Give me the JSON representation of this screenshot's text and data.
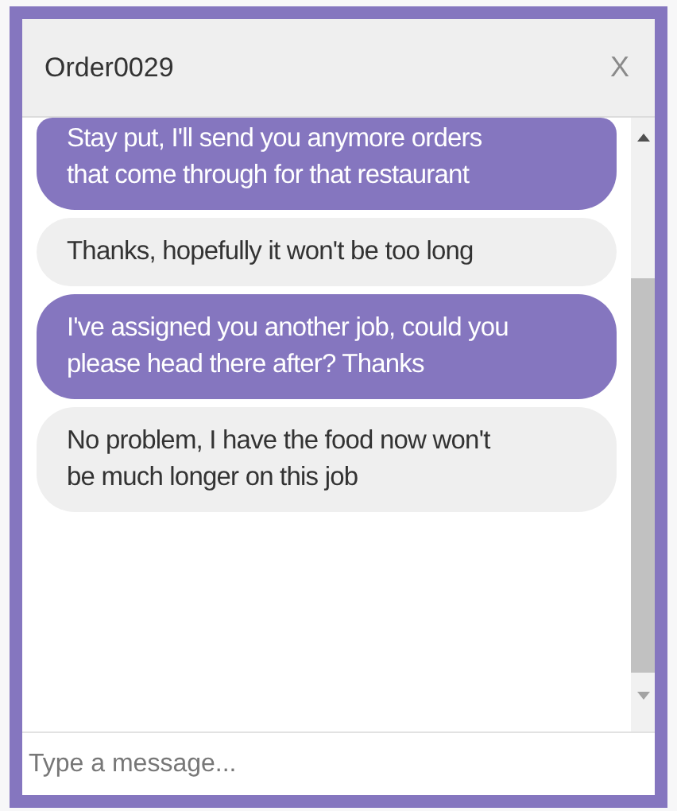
{
  "chat": {
    "title": "Order0029",
    "close": "X"
  },
  "messages": [
    {
      "kind": "sent",
      "text": "Stay put, I'll send you anymore orders that come through for that restaurant"
    },
    {
      "kind": "received",
      "text": "Thanks, hopefully it won't be too long"
    },
    {
      "kind": "sent",
      "text": "I've assigned you another job, could you please head there after? Thanks"
    },
    {
      "kind": "received",
      "text": "No problem, I have the food now won't be much longer on this job"
    }
  ],
  "composer": {
    "placeholder": "Type a message..."
  }
}
